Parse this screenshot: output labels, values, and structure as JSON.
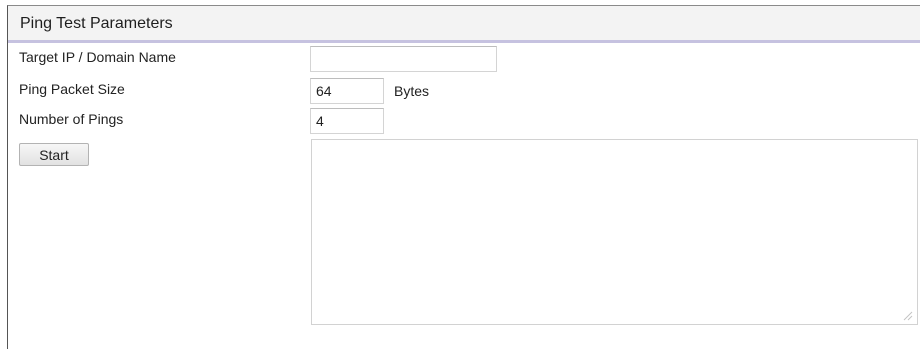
{
  "panel": {
    "title": "Ping Test Parameters"
  },
  "fields": {
    "target": {
      "label": "Target IP / Domain Name",
      "value": ""
    },
    "packet_size": {
      "label": "Ping Packet Size",
      "value": "64",
      "unit": "Bytes"
    },
    "ping_count": {
      "label": "Number of Pings",
      "value": "4"
    }
  },
  "actions": {
    "start_label": "Start"
  },
  "output": {
    "value": ""
  },
  "colors": {
    "header_background": "#f3f3f3",
    "header_accent": "#c6c2e0",
    "input_border": "#d4d4d4"
  }
}
